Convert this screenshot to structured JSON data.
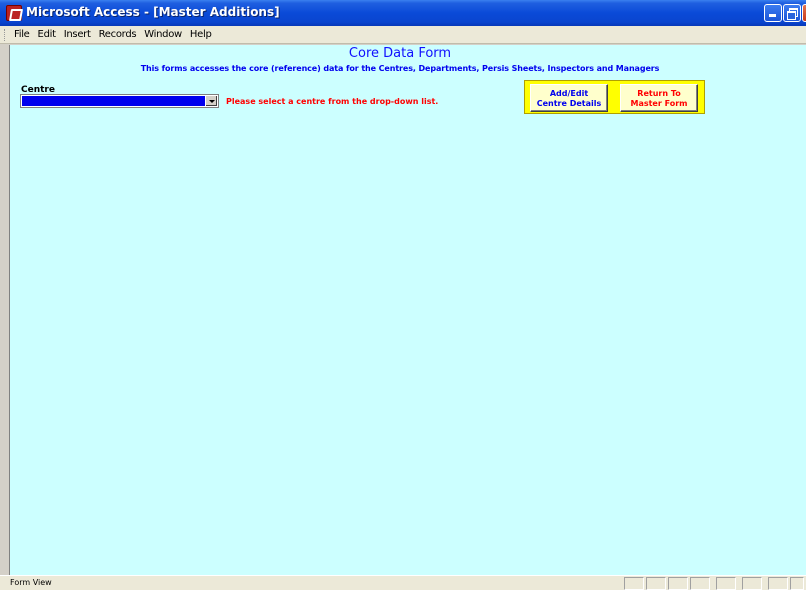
{
  "window": {
    "title": "Microsoft Access - [Master Additions]"
  },
  "menu": [
    "File",
    "Edit",
    "Insert",
    "Records",
    "Window",
    "Help"
  ],
  "form": {
    "title": "Core Data Form",
    "subtitle": "This forms accesses the core (reference) data for the Centres, Departments, Persis Sheets, Inspectors and Managers",
    "centre_label": "Centre",
    "centre_value": "",
    "hint": "Please select a centre from the drop-down list.",
    "add_edit_line1": "Add/Edit",
    "add_edit_line2": "Centre Details",
    "return_line1": "Return To",
    "return_line2": "Master Form"
  },
  "status": {
    "text": "Form View"
  },
  "colors": {
    "form_background": "#ccffff",
    "button_panel": "#ffff00",
    "hint_text": "#ff0000",
    "combo_fill": "#0000ee"
  }
}
